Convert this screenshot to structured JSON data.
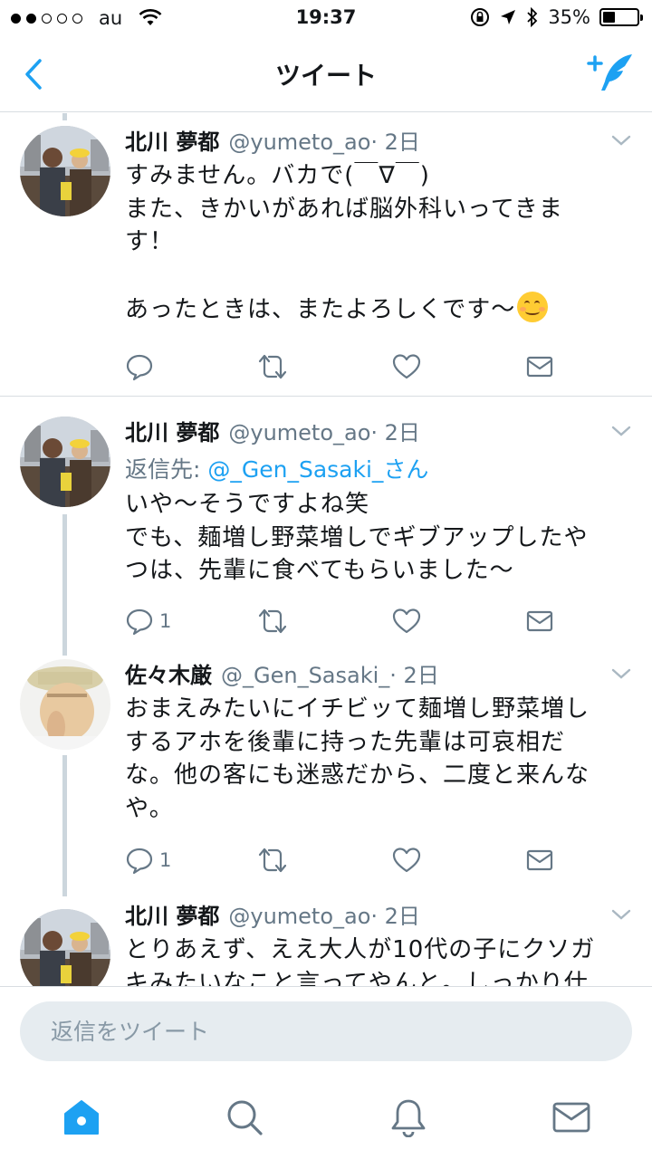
{
  "status_bar": {
    "carrier": "au",
    "time": "19:37",
    "battery_percent": "35%",
    "battery_level": 0.35
  },
  "nav": {
    "title": "ツイート",
    "back_icon": "chevron-left-icon",
    "compose_icon": "compose-tweet-icon"
  },
  "tweets": [
    {
      "name": "北川 夢都",
      "handle": "@yumeto_ao",
      "time": "· 2日",
      "lines": [
        "すみません。バカで(￣∇￣)",
        "また、きかいがあれば脳外科いってきま",
        "す！",
        "",
        "あったときは、またよろしくです〜"
      ],
      "reply_count": "",
      "colors": {
        "accent": "#1da1f2",
        "icon": "#657786"
      }
    },
    {
      "name": "北川 夢都",
      "handle": "@yumeto_ao",
      "time": "· 2日",
      "reply_to_label": "返信先: ",
      "reply_to_mention": "@_Gen_Sasaki_さん",
      "lines": [
        "いや〜そうですよね笑",
        "でも、麺増し野菜増しでギブアップしたや",
        "つは、先輩に食べてもらいました〜"
      ],
      "reply_count": "1"
    },
    {
      "name": "佐々木厳",
      "handle": "@_Gen_Sasaki_",
      "time": "· 2日",
      "lines": [
        "おまえみたいにイチビッて麺増し野菜増し",
        "するアホを後輩に持った先輩は可哀相だ",
        "な。他の客にも迷惑だから、二度と来んな",
        "や。"
      ],
      "reply_count": "1"
    },
    {
      "name": "北川 夢都",
      "handle": "@yumeto_ao",
      "time": "· 2日",
      "lines": [
        "とりあえず、ええ大人が10代の子にクソガ",
        "キみたいなこと言ってやんと。しっかり仕"
      ]
    }
  ],
  "reply_bar": {
    "placeholder": "返信をツイート"
  },
  "tab_bar": {
    "items": [
      "home-icon",
      "search-icon",
      "notifications-icon",
      "messages-icon"
    ],
    "active": "home-icon"
  }
}
